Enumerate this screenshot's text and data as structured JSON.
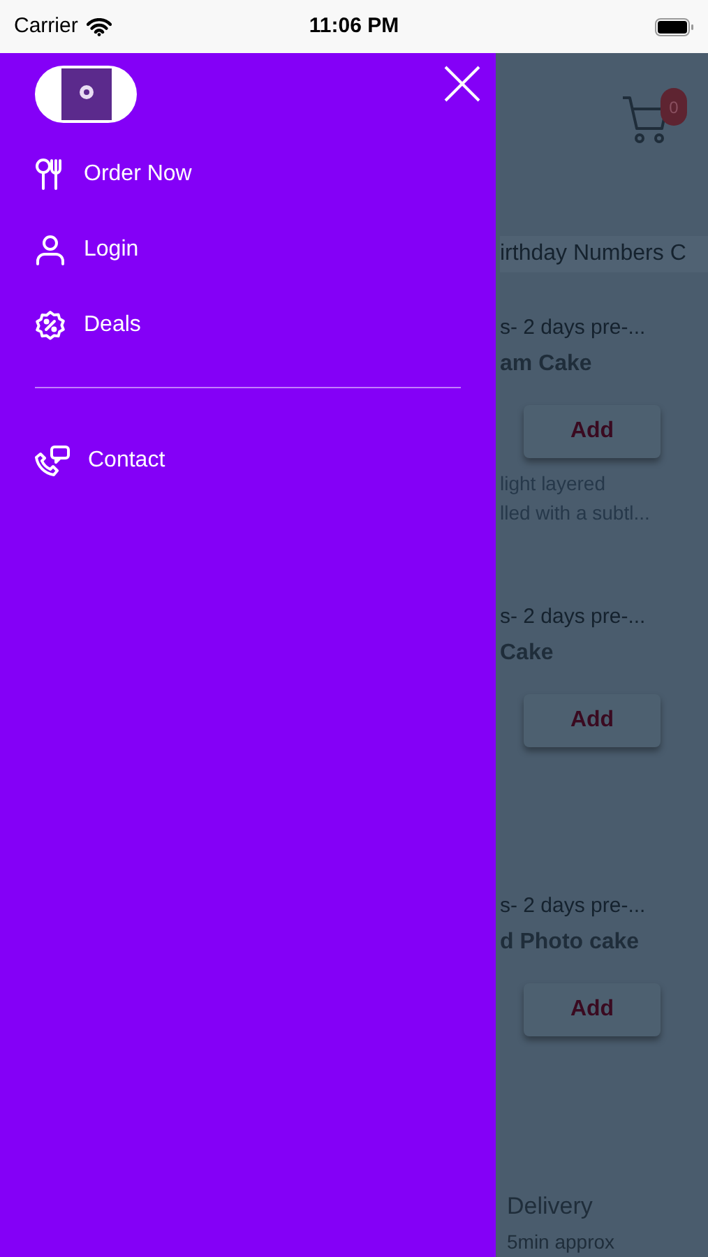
{
  "status_bar": {
    "carrier": "Carrier",
    "time": "11:06 PM"
  },
  "drawer": {
    "items": [
      {
        "label": "Order Now",
        "kind": "order"
      },
      {
        "label": "Login",
        "kind": "login"
      },
      {
        "label": "Deals",
        "kind": "deals"
      }
    ],
    "footer_items": [
      {
        "label": "Contact",
        "kind": "contact"
      }
    ]
  },
  "page": {
    "cart_count": "0",
    "search_text": "irthday Numbers C",
    "products": [
      {
        "subtitle": "s- 2 days pre-...",
        "title": "am Cake",
        "button": "Add",
        "description": [
          "light layered",
          "lled with a subtl..."
        ]
      },
      {
        "subtitle": "s- 2 days pre-...",
        "title": "Cake",
        "button": "Add"
      },
      {
        "subtitle": "s- 2 days pre-...",
        "title": "d Photo cake",
        "button": "Add"
      }
    ],
    "delivery": {
      "label": "Delivery",
      "time": "5min approx"
    }
  }
}
